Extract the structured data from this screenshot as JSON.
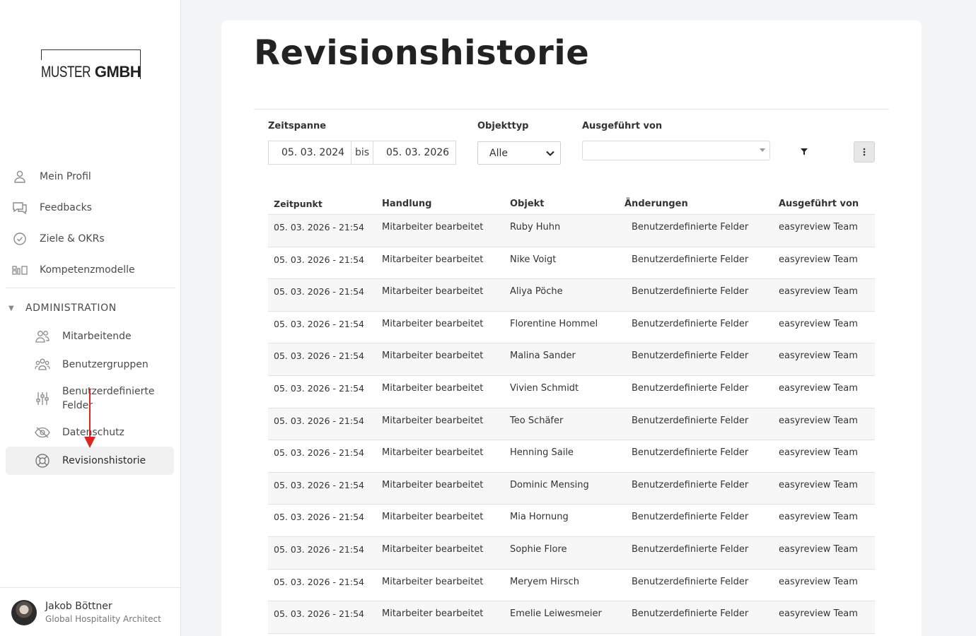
{
  "brand": {
    "logo_part1": "MUSTER",
    "logo_part2": "GMBH"
  },
  "sidebar": {
    "items": [
      {
        "label": "Mein Profil",
        "icon": "user-icon"
      },
      {
        "label": "Feedbacks",
        "icon": "chat-icon"
      },
      {
        "label": "Ziele & OKRs",
        "icon": "check-circle-icon"
      },
      {
        "label": "Kompetenzmodelle",
        "icon": "blocks-icon"
      }
    ],
    "section_title": "ADMINISTRATION",
    "admin_items": [
      {
        "label": "Mitarbeitende",
        "icon": "users-icon"
      },
      {
        "label": "Benutzergruppen",
        "icon": "group-icon"
      },
      {
        "label": "Benutzerdefinierte Felder",
        "icon": "sliders-icon"
      },
      {
        "label": "Datenschutz",
        "icon": "eye-off-icon"
      },
      {
        "label": "Revisionshistorie",
        "icon": "lifebuoy-icon",
        "active": true
      }
    ]
  },
  "user": {
    "name": "Jakob Böttner",
    "role": "Global Hospitality Architect"
  },
  "page": {
    "title": "Revisionshistorie"
  },
  "filters": {
    "timespan_label": "Zeitspanne",
    "date_from": "05. 03. 2024",
    "date_sep": "bis",
    "date_to": "05. 03. 2026",
    "object_type_label": "Objekttyp",
    "object_type_value": "Alle",
    "executed_by_label": "Ausgeführt von",
    "executed_by_value": ""
  },
  "table": {
    "headers": [
      "Zeitpunkt",
      "Handlung",
      "Objekt",
      "Änderungen",
      "Ausgeführt von"
    ],
    "rows": [
      [
        "05. 03. 2026 - 21:54",
        "Mitarbeiter bearbeitet",
        "Ruby Huhn",
        "Benutzerdefinierte Felder",
        "easyreview Team"
      ],
      [
        "05. 03. 2026 - 21:54",
        "Mitarbeiter bearbeitet",
        "Nike Voigt",
        "Benutzerdefinierte Felder",
        "easyreview Team"
      ],
      [
        "05. 03. 2026 - 21:54",
        "Mitarbeiter bearbeitet",
        "Aliya Pöche",
        "Benutzerdefinierte Felder",
        "easyreview Team"
      ],
      [
        "05. 03. 2026 - 21:54",
        "Mitarbeiter bearbeitet",
        "Florentine Hommel",
        "Benutzerdefinierte Felder",
        "easyreview Team"
      ],
      [
        "05. 03. 2026 - 21:54",
        "Mitarbeiter bearbeitet",
        "Malina Sander",
        "Benutzerdefinierte Felder",
        "easyreview Team"
      ],
      [
        "05. 03. 2026 - 21:54",
        "Mitarbeiter bearbeitet",
        "Vivien Schmidt",
        "Benutzerdefinierte Felder",
        "easyreview Team"
      ],
      [
        "05. 03. 2026 - 21:54",
        "Mitarbeiter bearbeitet",
        "Teo Schäfer",
        "Benutzerdefinierte Felder",
        "easyreview Team"
      ],
      [
        "05. 03. 2026 - 21:54",
        "Mitarbeiter bearbeitet",
        "Henning Saile",
        "Benutzerdefinierte Felder",
        "easyreview Team"
      ],
      [
        "05. 03. 2026 - 21:54",
        "Mitarbeiter bearbeitet",
        "Dominic Mensing",
        "Benutzerdefinierte Felder",
        "easyreview Team"
      ],
      [
        "05. 03. 2026 - 21:54",
        "Mitarbeiter bearbeitet",
        "Mia Hornung",
        "Benutzerdefinierte Felder",
        "easyreview Team"
      ],
      [
        "05. 03. 2026 - 21:54",
        "Mitarbeiter bearbeitet",
        "Sophie Flore",
        "Benutzerdefinierte Felder",
        "easyreview Team"
      ],
      [
        "05. 03. 2026 - 21:54",
        "Mitarbeiter bearbeitet",
        "Meryem Hirsch",
        "Benutzerdefinierte Felder",
        "easyreview Team"
      ],
      [
        "05. 03. 2026 - 21:54",
        "Mitarbeiter bearbeitet",
        "Emelie Leiwesmeier",
        "Benutzerdefinierte Felder",
        "easyreview Team"
      ]
    ]
  },
  "colors": {
    "annotation_arrow": "#e02424",
    "active_bg": "#f1f1f1"
  }
}
